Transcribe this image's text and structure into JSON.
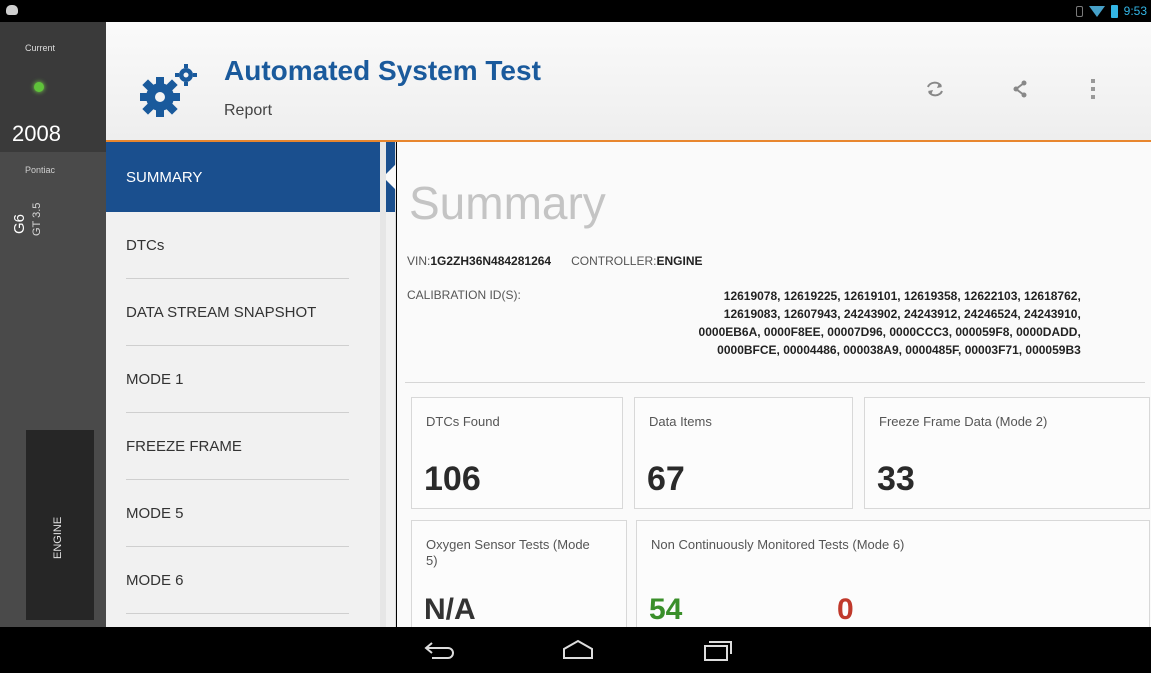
{
  "status_bar": {
    "time": "9:53",
    "icons": [
      "notification-icon",
      "vibrate-icon",
      "wifi-icon",
      "battery-icon"
    ]
  },
  "vehicle_rail": {
    "current_label": "Current",
    "year": "2008",
    "make": "Pontiac",
    "model": "G6",
    "trim": "GT 3.5",
    "controller_tab": "ENGINE",
    "status_color": "#5fc33a"
  },
  "header": {
    "title": "Automated System Test",
    "subtitle": "Report",
    "icons": [
      "gears-icon",
      "refresh-icon",
      "share-icon",
      "overflow-menu-icon"
    ],
    "title_color": "#1a5a9c",
    "accent_color": "#e8862e"
  },
  "nav": {
    "items": [
      {
        "label": "SUMMARY",
        "active": true
      },
      {
        "label": "DTCs",
        "active": false
      },
      {
        "label": "DATA STREAM SNAPSHOT",
        "active": false
      },
      {
        "label": "MODE 1",
        "active": false
      },
      {
        "label": "FREEZE FRAME",
        "active": false
      },
      {
        "label": "MODE 5",
        "active": false
      },
      {
        "label": "MODE 6",
        "active": false
      }
    ],
    "active_color": "#1a4f8e"
  },
  "summary": {
    "title": "Summary",
    "vin_label": "VIN:",
    "vin": "1G2ZH36N484281264",
    "controller_label": "CONTROLLER:",
    "controller": "ENGINE",
    "calibration_label": "CALIBRATION ID(S):",
    "calibration_lines": [
      "12619078, 12619225, 12619101, 12619358, 12622103, 12618762,",
      "12619083, 12607943, 24243902, 24243912, 24246524, 24243910,",
      "0000EB6A, 0000F8EE, 00007D96, 0000CCC3, 000059F8, 0000DADD,",
      "0000BFCE, 00004486, 000038A9, 0000485F, 00003F71, 000059B3"
    ],
    "cards": {
      "dtcs_found": {
        "label": "DTCs Found",
        "value": "106"
      },
      "data_items": {
        "label": "Data Items",
        "value": "67"
      },
      "freeze_frame": {
        "label": "Freeze Frame Data (Mode 2)",
        "value": "33"
      },
      "oxygen": {
        "label": "Oxygen Sensor Tests (Mode 5)",
        "value": "N/A"
      },
      "non_continuous": {
        "label": "Non Continuously Monitored Tests (Mode 6)",
        "passed_value": "54",
        "failed_value": "0"
      }
    }
  },
  "system_nav": {
    "icons": [
      "back-icon",
      "home-icon",
      "recents-icon"
    ]
  }
}
